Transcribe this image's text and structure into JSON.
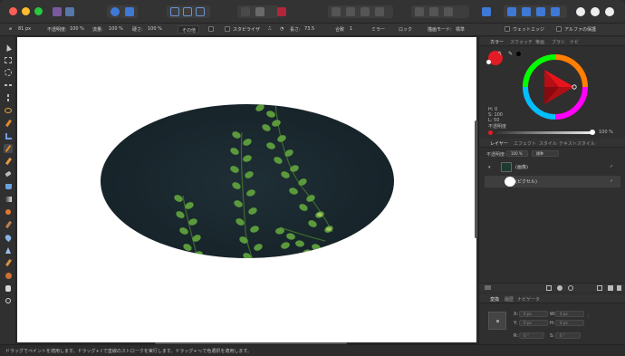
{
  "toolbar": {
    "size_value": "81 px",
    "opacity_label": "不透明度:",
    "opacity_value": "100 %",
    "flow_label": "流量:",
    "flow_value": "100 %",
    "hardness_label": "硬さ:",
    "hardness_value": "100 %",
    "more_label": "その他",
    "stabilizer_label": "スタビライザ",
    "length_label": "長さ:",
    "length_value": "73.5",
    "mode_label": "合致",
    "mode_value": "1",
    "mirror_label": "ミラー",
    "lock_label": "ロック",
    "wet_edges_label": "ウェットエッジ",
    "protect_alpha_label": "アルファの保護",
    "blend_label": "描画モード:",
    "blend_value": "標準"
  },
  "color_panel": {
    "tabs": [
      "カラー",
      "スウォッチ",
      "筆画",
      "ブラシ",
      "ナビ"
    ],
    "h_label": "H: 0",
    "s_label": "S: 100",
    "l_label": "L: 50",
    "opacity_label": "不透明度",
    "opacity_value": "100 %",
    "current_color": "#ff0000"
  },
  "layers_panel": {
    "tabs": [
      "レイヤー",
      "エフェクト",
      "スタイル",
      "テキストスタイル"
    ],
    "opacity_label": "不透明度:",
    "opacity_value": "100 %",
    "blend_value": "標準",
    "layers": [
      {
        "name": "(画像)"
      },
      {
        "name": "(ピクセル)"
      }
    ]
  },
  "transform_panel": {
    "tabs": [
      "変換",
      "履歴",
      "ナビゲータ"
    ],
    "x_label": "X:",
    "x_value": "0 px",
    "y_label": "Y:",
    "y_value": "0 px",
    "w_label": "W:",
    "w_value": "0 px",
    "h_label": "H:",
    "h_value": "0 px",
    "r_label": "R:",
    "r_value": "0 °",
    "s_label": "S:",
    "s_value": "0 °"
  },
  "status": {
    "text": "ドラッグでペイントを適用します。ドラッグ+⇧で直線のストロークを実行します。ドラッグ+⌥で色選択を適用します。"
  },
  "colors": {
    "accent": "#2d6fd0",
    "brush_red": "#e21c24",
    "canvas": "#ffffff",
    "photo_bg": "#1c2a30",
    "leaf": "#5a9a3a"
  }
}
